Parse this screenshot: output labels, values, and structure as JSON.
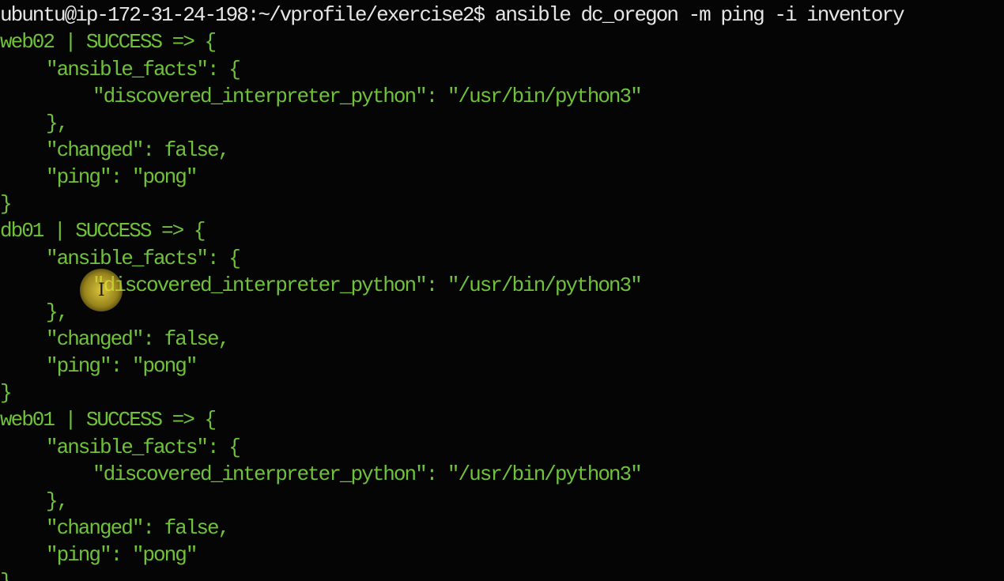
{
  "prompt": "ubuntu@ip-172-31-24-198:~/vprofile/exercise2$ ansible dc_oregon -m ping -i inventory",
  "results": [
    {
      "header": "web02 | SUCCESS => {",
      "facts_open": "\"ansible_facts\": {",
      "interpreter": "\"discovered_interpreter_python\": \"/usr/bin/python3\"",
      "facts_close": "},",
      "changed": "\"changed\": false,",
      "ping": "\"ping\": \"pong\"",
      "close": "}"
    },
    {
      "header": "db01 | SUCCESS => {",
      "facts_open": "\"ansible_facts\": {",
      "interpreter": "\"discovered_interpreter_python\": \"/usr/bin/python3\"",
      "facts_close": "},",
      "changed": "\"changed\": false,",
      "ping": "\"ping\": \"pong\"",
      "close": "}"
    },
    {
      "header": "web01 | SUCCESS => {",
      "facts_open": "\"ansible_facts\": {",
      "interpreter": "\"discovered_interpreter_python\": \"/usr/bin/python3\"",
      "facts_close": "},",
      "changed": "\"changed\": false,",
      "ping": "\"ping\": \"pong\"",
      "close": "}"
    }
  ],
  "colors": {
    "background": "#050505",
    "prompt_text": "#e6e6e6",
    "success_output": "#6fc23a",
    "cursor_highlight": "#e8c832"
  },
  "icons": {
    "pointer": "text-cursor-icon"
  }
}
